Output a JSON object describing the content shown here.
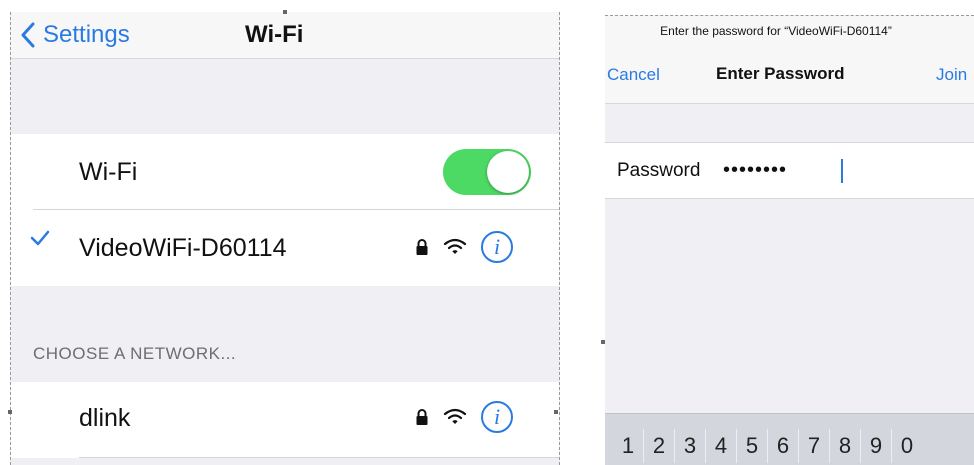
{
  "left_screen": {
    "back_label": "Settings",
    "title": "Wi-Fi",
    "wifi_toggle": {
      "label": "Wi-Fi",
      "on": true
    },
    "connected_network": {
      "name": "VideoWiFi-D60114",
      "secured": true,
      "selected": true
    },
    "section_header": "CHOOSE A NETWORK...",
    "networks": [
      {
        "name": "dlink",
        "secured": true
      }
    ],
    "icons": {
      "lock": "lock-icon",
      "wifi": "wifi-signal-icon",
      "info": "info-icon",
      "check": "checkmark-icon",
      "back": "chevron-left-icon"
    },
    "info_glyph": "i"
  },
  "right_screen": {
    "prompt": "Enter the password for “VideoWiFi-D60114”",
    "cancel_label": "Cancel",
    "title": "Enter Password",
    "join_label": "Join",
    "password_label": "Password",
    "password_value": "••••••••",
    "keyboard_keys": [
      "1",
      "2",
      "3",
      "4",
      "5",
      "6",
      "7",
      "8",
      "9",
      "0"
    ]
  },
  "colors": {
    "accent_blue": "#2a7ae2",
    "toggle_green": "#4cd964",
    "group_background": "#efeff4",
    "section_header_gray": "#6d6d72"
  }
}
